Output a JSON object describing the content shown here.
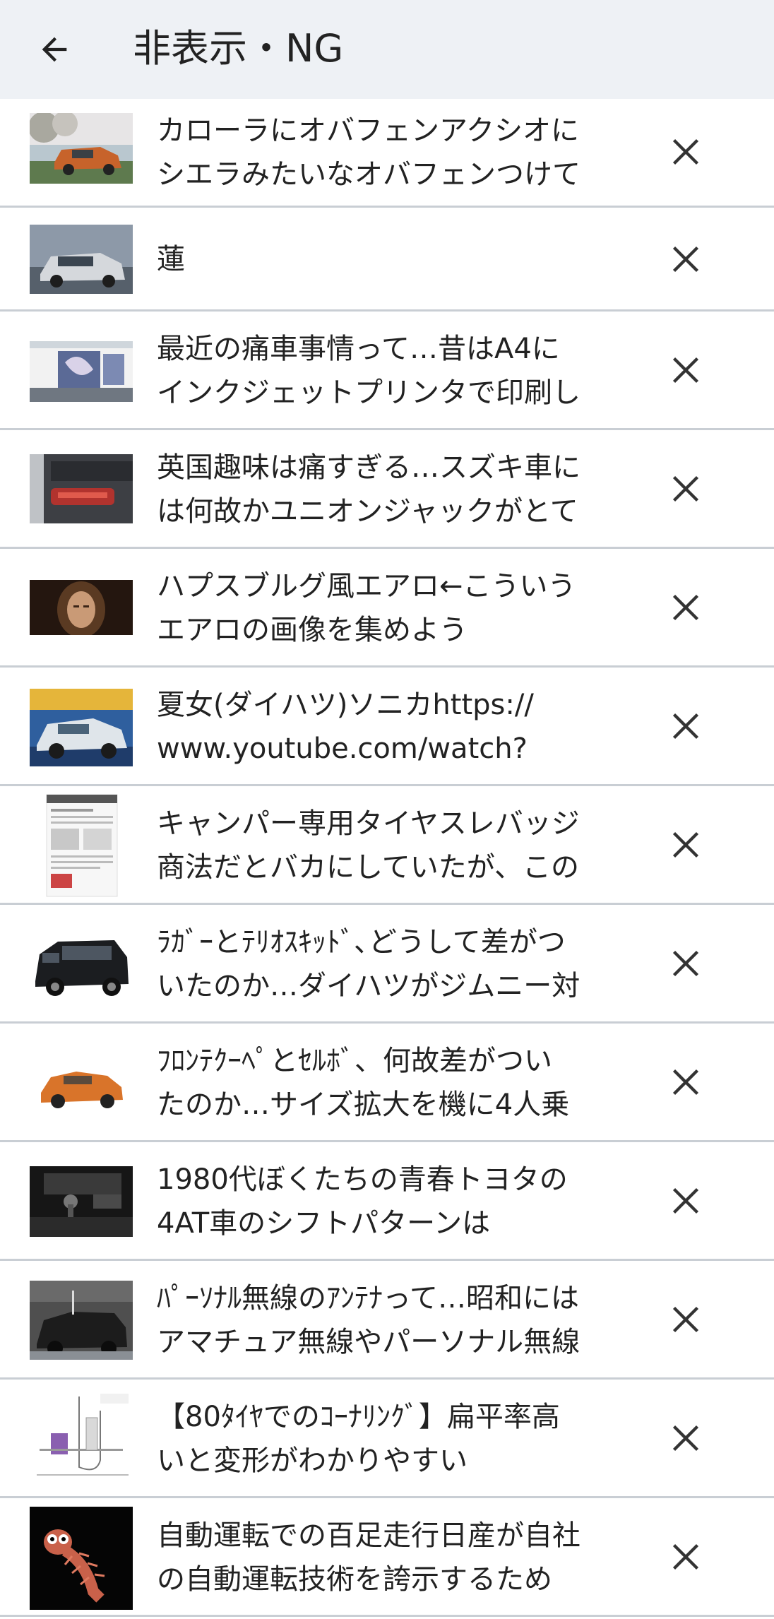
{
  "header": {
    "title": "非表示・NG",
    "back_icon": "arrow-left-icon"
  },
  "colors": {
    "header_bg": "#eef1f5",
    "divider": "#c9ced4",
    "text": "#222222"
  },
  "items": [
    {
      "line1": "カローラにオバフェンアクシオに",
      "line2": "シエラみたいなオバフェンつけて"
    },
    {
      "line1": "蓮",
      "line2": ""
    },
    {
      "line1": "最近の痛車事情って…昔はA4に",
      "line2": "インクジェットプリンタで印刷し"
    },
    {
      "line1": "英国趣味は痛すぎる…スズキ車に",
      "line2": "は何故かユニオンジャックがとて"
    },
    {
      "line1": "ハプスブルグ風エアロ←こういう",
      "line2": "エアロの画像を集めよう"
    },
    {
      "line1": "夏女(ダイハツ)ソニカhttps://",
      "line2": "www.youtube.com/watch?"
    },
    {
      "line1": "キャンパー専用タイヤスレバッジ",
      "line2": "商法だとバカにしていたが、この"
    },
    {
      "line1": "ﾗｶﾞｰとﾃﾘｵｽｷｯﾄﾞ､どうして差がつ",
      "line2": "いたのか…ダイハツがジムニー対"
    },
    {
      "line1": "ﾌﾛﾝﾃｸｰﾍﾟとｾﾙﾎﾞ、何故差がつい",
      "line2": "たのか…サイズ拡大を機に4人乗"
    },
    {
      "line1": "1980代ぼくたちの青春トヨタの",
      "line2": "4AT車のシフトパターンは"
    },
    {
      "line1": "ﾊﾟｰｿﾅﾙ無線のｱﾝﾃﾅって…昭和には",
      "line2": "アマチュア無線やパーソナル無線"
    },
    {
      "line1": "【80ﾀｲﾔでのｺｰﾅﾘﾝｸﾞ】扁平率高",
      "line2": "いと変形がわかりやすい"
    },
    {
      "line1": "自動運転での百足走行日産が自社",
      "line2": "の自動運転技術を誇示するため"
    }
  ]
}
